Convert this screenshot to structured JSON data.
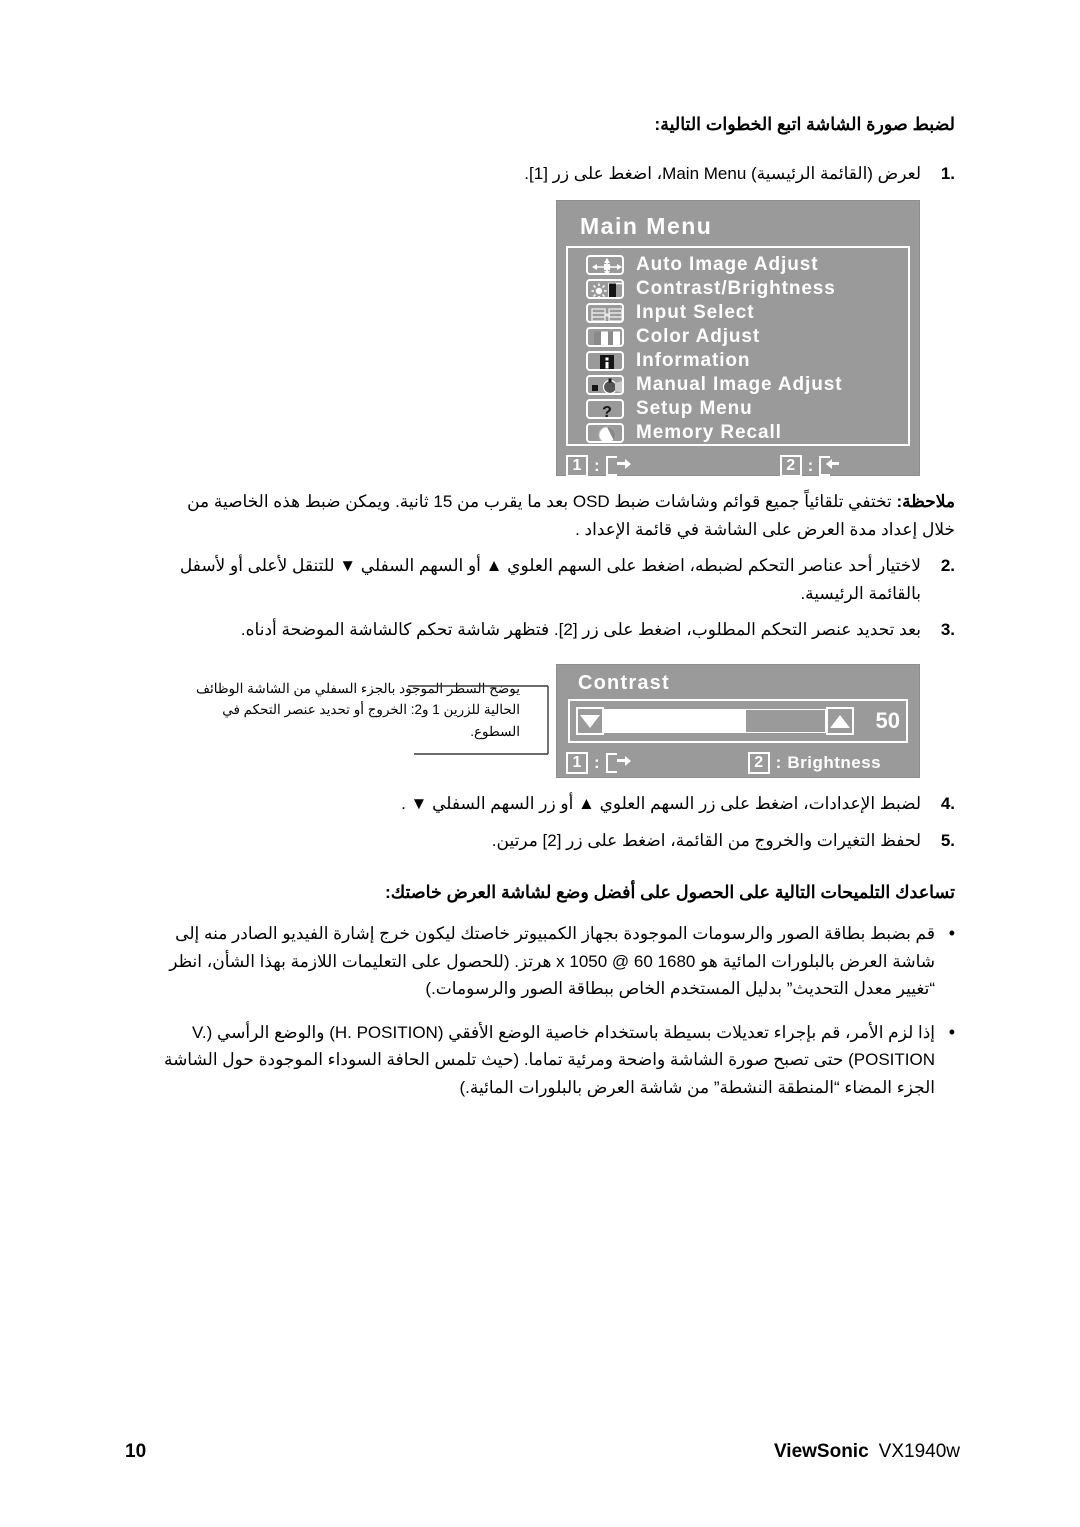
{
  "document": {
    "heading": "لضبط صورة الشاشة اتبع الخطوات التالية:",
    "steps": [
      {
        "num": "1.",
        "text": "لعرض (القائمة الرئيسية) Main Menu، اضغط على زر [1]."
      },
      {
        "num": "2.",
        "text": "لاختيار أحد عناصر التحكم لضبطه، اضغط على السهم العلوي ▲ أو السهم السفلي ▼ للتنقل لأعلى أو لأسفل بالقائمة الرئيسية."
      },
      {
        "num": "3.",
        "text": "بعد تحديد عنصر التحكم المطلوب، اضغط على زر [2]. فتظهر شاشة تحكم كالشاشة الموضحة أدناه."
      },
      {
        "num": "4.",
        "text": "لضبط الإعدادات، اضغط على زر السهم العلوي ▲ أو زر السهم السفلي ▼ ."
      },
      {
        "num": "5.",
        "text": "لحفظ التغيرات والخروج من القائمة، اضغط على زر [2] مرتين."
      }
    ],
    "note": {
      "label": "ملاحظة:",
      "text": " تختفي تلقائياً جميع قوائم وشاشات ضبط OSD بعد ما يقرب من 15 ثانية. ويمكن ضبط هذه الخاصية من خلال إعداد مدة العرض على الشاشة في قائمة الإعداد ."
    },
    "callout": "يوضح السطر الموجود بالجزء السفلي من الشاشة الوظائف الحالية للزرين 1 و2: الخروج أو تحديد عنصر التحكم في السطوع.",
    "tips_heading": "تساعدك التلميحات التالية على الحصول على أفضل وضع لشاشة العرض خاصتك:",
    "tips": [
      "قم بضبط بطاقة الصور والرسومات الموجودة بجهاز الكمبيوتر خاصتك ليكون خرج إشارة الفيديو الصادر منه إلى شاشة العرض بالبلورات المائية هو 1680 x 1050 @ 60 هرتز. (للحصول على التعليمات اللازمة بهذا الشأن، انظر “تغيير معدل التحديث” بدليل المستخدم الخاص ببطاقة الصور والرسومات.)",
      "إذا لزم الأمر، قم بإجراء تعديلات بسيطة باستخدام خاصية الوضع الأفقي (H. POSITION) والوضع الرأسي (V. POSITION) حتى تصبح صورة الشاشة واضحة ومرئية تماما. (حيث تلمس الحافة السوداء الموجودة حول الشاشة الجزء المضاء “المنطقة النشطة” من شاشة العرض بالبلورات المائية.)"
    ]
  },
  "main_menu_osd": {
    "title": "Main Menu",
    "items": [
      {
        "label": "Auto Image Adjust",
        "icon": "auto-image-adjust-icon"
      },
      {
        "label": "Contrast/Brightness",
        "icon": "contrast-brightness-icon"
      },
      {
        "label": "Input Select",
        "icon": "input-select-icon"
      },
      {
        "label": "Color Adjust",
        "icon": "color-adjust-icon"
      },
      {
        "label": "Information",
        "icon": "information-icon"
      },
      {
        "label": "Manual Image Adjust",
        "icon": "manual-image-adjust-icon"
      },
      {
        "label": "Setup Menu",
        "icon": "setup-menu-icon"
      },
      {
        "label": "Memory Recall",
        "icon": "memory-recall-icon"
      }
    ],
    "footer": {
      "key1": "1",
      "key1_colon": ":",
      "key1_action": "exit-icon",
      "key2": "2",
      "key2_colon": ":",
      "key2_action": "enter-icon"
    }
  },
  "contrast_osd": {
    "title": "Contrast",
    "value": "50",
    "fill_percent": 64,
    "footer": {
      "key1": "1",
      "key1_colon": ":",
      "key1_action": "exit-icon",
      "key2": "2",
      "key2_colon": ":",
      "key2_label": "Brightness"
    }
  },
  "footer": {
    "page_number": "10",
    "brand": "ViewSonic",
    "model": "VX1940w"
  },
  "colors": {
    "osd_background": "#9a9a9a",
    "osd_text": "#ffffff",
    "page_background": "#ffffff",
    "body_text": "#000000"
  }
}
